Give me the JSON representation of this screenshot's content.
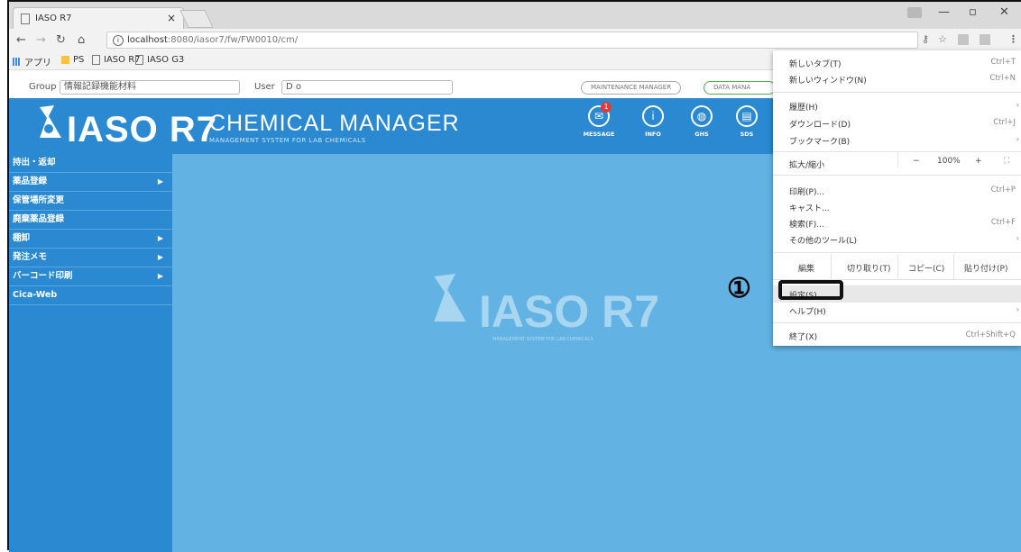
{
  "browser": {
    "tab_title": "IASO R7",
    "url_host": "localhost",
    "url_path": ":8080/iasor7/fw/FW0010/cm/",
    "bookmarks": [
      "アプリ",
      "PS",
      "IASO R7",
      "IASO G3"
    ]
  },
  "app": {
    "group_label": "Group",
    "group_value": "情報記録機能材料",
    "user_label": "User",
    "user_value": "D o",
    "maintenance_label": "MAINTENANCE MANAGER",
    "data_label": "DATA MANA",
    "logo_text": "IASO R7",
    "title": "CHEMICAL MANAGER",
    "subtitle": "MANAGEMENT SYSTEM FOR LAB CHEMICALS",
    "header_icons": [
      {
        "name": "message-icon",
        "label": "MESSAGE",
        "badge": "1",
        "glyph": "✉"
      },
      {
        "name": "info-icon",
        "label": "INFO",
        "glyph": "i"
      },
      {
        "name": "ghs-icon",
        "label": "GHS",
        "glyph": "◍"
      },
      {
        "name": "sds-icon",
        "label": "SDS",
        "glyph": "▤"
      }
    ],
    "watermark": "IASO R7",
    "watermark_sub": "MANAGEMENT SYSTEM FOR LAB CHEMICALS"
  },
  "sidebar": {
    "items": [
      {
        "label": "持出・返却",
        "arrow": false
      },
      {
        "label": "薬品登録",
        "arrow": true
      },
      {
        "label": "保管場所変更",
        "arrow": false
      },
      {
        "label": "廃棄薬品登録",
        "arrow": false
      },
      {
        "label": "棚卸",
        "arrow": true
      },
      {
        "label": "発注メモ",
        "arrow": true
      },
      {
        "label": "バーコード印刷",
        "arrow": true
      },
      {
        "label": "Cica-Web",
        "arrow": false
      }
    ]
  },
  "menu": {
    "new_tab": "新しいタブ(T)",
    "new_tab_sc": "Ctrl+T",
    "new_window": "新しいウィンドウ(N)",
    "new_window_sc": "Ctrl+N",
    "history": "履歴(H)",
    "downloads": "ダウンロード(D)",
    "downloads_sc": "Ctrl+J",
    "bookmarks": "ブックマーク(B)",
    "zoom": "拡大/縮小",
    "zoom_minus": "−",
    "zoom_value": "100%",
    "zoom_plus": "+",
    "print": "印刷(P)...",
    "print_sc": "Ctrl+P",
    "cast": "キャスト...",
    "find": "検索(F)...",
    "find_sc": "Ctrl+F",
    "more_tools": "その他のツール(L)",
    "edit": "編集",
    "cut": "切り取り(T)",
    "copy": "コピー(C)",
    "paste": "貼り付け(P)",
    "settings": "設定(S)",
    "help": "ヘルプ(H)",
    "exit": "終了(X)",
    "exit_sc": "Ctrl+Shift+Q"
  },
  "annotation": {
    "marker": "①"
  }
}
